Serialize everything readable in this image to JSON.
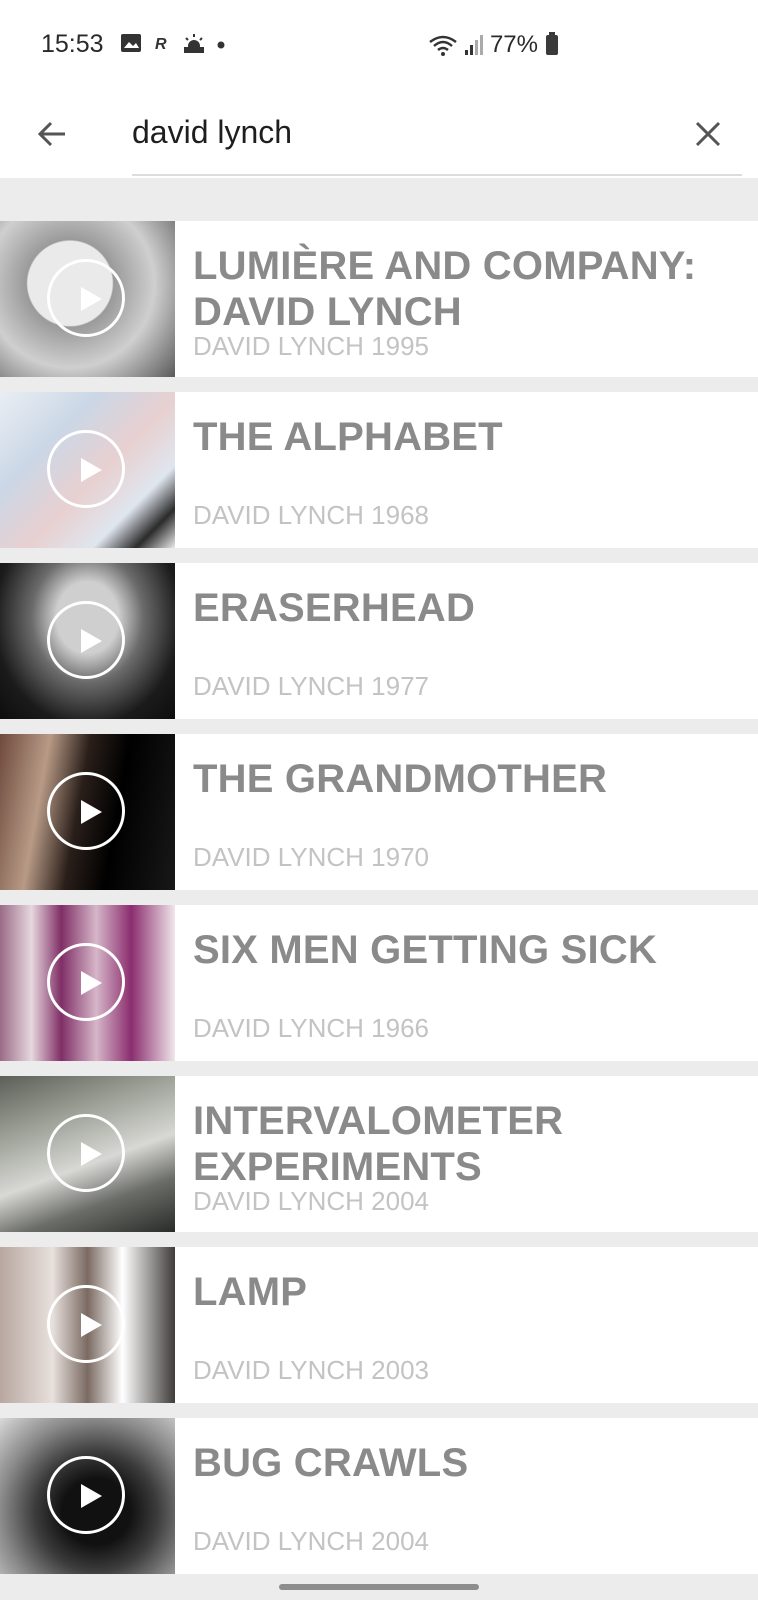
{
  "status_bar": {
    "time": "15:53",
    "battery": "77%"
  },
  "search": {
    "query": "david lynch"
  },
  "results": [
    {
      "title": "LUMIÈRE AND COMPANY: DAVID LYNCH",
      "subtitle": "DAVID LYNCH 1995"
    },
    {
      "title": "THE ALPHABET",
      "subtitle": "DAVID LYNCH 1968"
    },
    {
      "title": "ERASERHEAD",
      "subtitle": "DAVID LYNCH 1977"
    },
    {
      "title": "THE GRANDMOTHER",
      "subtitle": "DAVID LYNCH 1970"
    },
    {
      "title": "SIX MEN GETTING SICK",
      "subtitle": "DAVID LYNCH 1966"
    },
    {
      "title": "INTERVALOMETER EXPERIMENTS",
      "subtitle": "DAVID LYNCH 2004"
    },
    {
      "title": "LAMP",
      "subtitle": "DAVID LYNCH 2003"
    },
    {
      "title": "BUG CRAWLS",
      "subtitle": "DAVID LYNCH 2004"
    }
  ],
  "icons": {
    "back": "arrow-left-icon",
    "clear": "close-icon",
    "play": "play-icon"
  },
  "colors": {
    "title": "#8a8a8a",
    "subtitle": "#c3c3c3",
    "background": "#ececec"
  }
}
